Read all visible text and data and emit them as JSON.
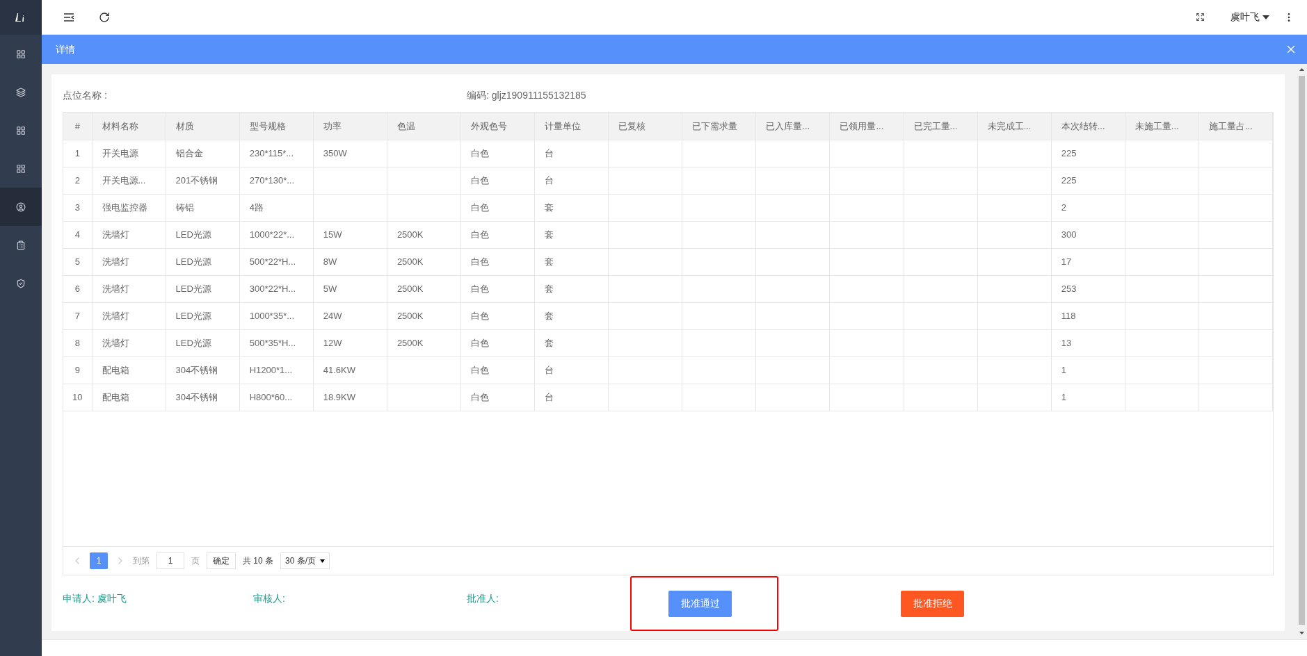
{
  "sidebar": {
    "items": [
      {
        "selected": false
      },
      {
        "selected": false
      },
      {
        "selected": false
      },
      {
        "selected": false
      },
      {
        "selected": true
      },
      {
        "selected": false
      },
      {
        "selected": false
      }
    ]
  },
  "topbar": {
    "user": "虞叶飞"
  },
  "dialog": {
    "title": "详情",
    "fields": [
      {
        "label": "点位名称 :"
      },
      {
        "label": "编码: gljz190911155132185"
      }
    ],
    "table": {
      "columns": [
        "#",
        "材料名称",
        "材质",
        "型号规格",
        "功率",
        "色温",
        "外观色号",
        "计量单位",
        "已复核",
        "已下需求量",
        "已入库量...",
        "已领用量...",
        "已完工量...",
        "未完成工...",
        "本次结转...",
        "未施工量...",
        "施工量占..."
      ],
      "rows": [
        [
          "1",
          "开关电源",
          "铝合金",
          "230*115*...",
          "350W",
          null,
          "白色",
          "台",
          null,
          null,
          null,
          null,
          null,
          null,
          "225",
          null,
          null
        ],
        [
          "2",
          "开关电源...",
          "201不锈钢",
          "270*130*...",
          null,
          null,
          "白色",
          "台",
          null,
          null,
          null,
          null,
          null,
          null,
          "225",
          null,
          null
        ],
        [
          "3",
          "强电监控器",
          "铸铝",
          "4路",
          null,
          null,
          "白色",
          "套",
          null,
          null,
          null,
          null,
          null,
          null,
          "2",
          null,
          null
        ],
        [
          "4",
          "洗墙灯",
          "LED光源",
          "1000*22*...",
          "15W",
          "2500K",
          "白色",
          "套",
          null,
          null,
          null,
          null,
          null,
          null,
          "300",
          null,
          null
        ],
        [
          "5",
          "洗墙灯",
          "LED光源",
          "500*22*H...",
          "8W",
          "2500K",
          "白色",
          "套",
          null,
          null,
          null,
          null,
          null,
          null,
          "17",
          null,
          null
        ],
        [
          "6",
          "洗墙灯",
          "LED光源",
          "300*22*H...",
          "5W",
          "2500K",
          "白色",
          "套",
          null,
          null,
          null,
          null,
          null,
          null,
          "253",
          null,
          null
        ],
        [
          "7",
          "洗墙灯",
          "LED光源",
          "1000*35*...",
          "24W",
          "2500K",
          "白色",
          "套",
          null,
          null,
          null,
          null,
          null,
          null,
          "118",
          null,
          null
        ],
        [
          "8",
          "洗墙灯",
          "LED光源",
          "500*35*H...",
          "12W",
          "2500K",
          "白色",
          "套",
          null,
          null,
          null,
          null,
          null,
          null,
          "13",
          null,
          null
        ],
        [
          "9",
          "配电箱",
          "304不锈钢",
          "H1200*1...",
          "41.6KW",
          null,
          "白色",
          "台",
          null,
          null,
          null,
          null,
          null,
          null,
          "1",
          null,
          null
        ],
        [
          "10",
          "配电箱",
          "304不锈钢",
          "H800*60...",
          "18.9KW",
          null,
          "白色",
          "台",
          null,
          null,
          null,
          null,
          null,
          null,
          "1",
          null,
          null
        ]
      ]
    },
    "pagination": {
      "pages": [
        {
          "label": "1",
          "selected": true
        }
      ],
      "goto_label": "到第",
      "goto_value": "1",
      "page_unit": "页",
      "confirm": "确定",
      "total": "共 10 条",
      "page_size": "30 条/页"
    },
    "signatures": [
      {
        "label": "申请人: 虞叶飞"
      },
      {
        "label": "审核人:"
      },
      {
        "label": "批准人:"
      }
    ],
    "buttons": [
      {
        "label": "批准通过",
        "kind": "approve",
        "highlighted": true
      },
      {
        "label": "批准拒绝",
        "kind": "reject",
        "highlighted": false
      }
    ]
  }
}
